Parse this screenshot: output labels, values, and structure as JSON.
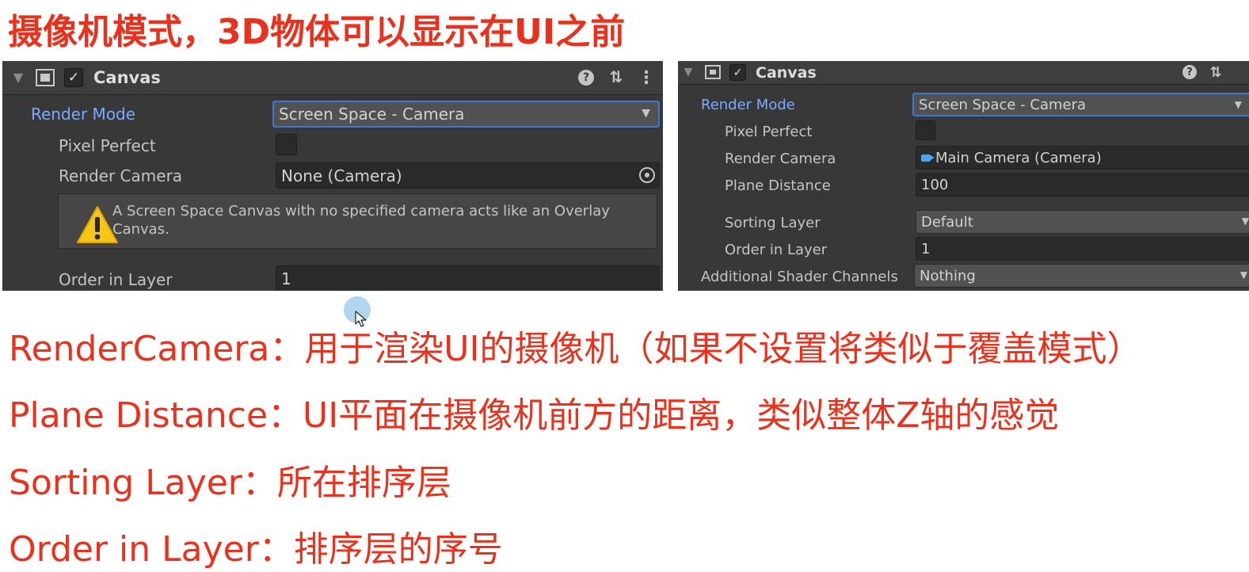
{
  "slide_title": "摄像机模式，3D物体可以显示在UI之前",
  "left_panel": {
    "component_title": "Canvas",
    "render_mode": {
      "label": "Render Mode",
      "value": "Screen Space - Camera"
    },
    "pixel_perfect": {
      "label": "Pixel Perfect",
      "checked": false
    },
    "render_camera": {
      "label": "Render Camera",
      "value": "None (Camera)"
    },
    "warning": "A Screen Space Canvas with no specified camera acts like an Overlay Canvas.",
    "order_in_layer": {
      "label": "Order in Layer",
      "value": "1"
    }
  },
  "right_panel": {
    "component_title": "Canvas",
    "render_mode": {
      "label": "Render Mode",
      "value": "Screen Space - Camera"
    },
    "pixel_perfect": {
      "label": "Pixel Perfect",
      "checked": false
    },
    "render_camera": {
      "label": "Render Camera",
      "value": "Main Camera (Camera)"
    },
    "plane_distance": {
      "label": "Plane Distance",
      "value": "100"
    },
    "sorting_layer": {
      "label": "Sorting Layer",
      "value": "Default"
    },
    "order_in_layer": {
      "label": "Order in Layer",
      "value": "1"
    },
    "additional_shader_channels": {
      "label": "Additional Shader Channels",
      "value": "Nothing"
    }
  },
  "notes": [
    "RenderCamera：用于渲染UI的摄像机（如果不设置将类似于覆盖模式）",
    "Plane Distance：UI平面在摄像机前方的距离，类似整体Z轴的感觉",
    "Sorting Layer：所在排序层",
    "Order in Layer：排序层的序号"
  ],
  "icons": {
    "foldout": "triangle-down-icon",
    "component": "canvas-component-icon",
    "enabled": "checkmark-icon",
    "help": "help-icon",
    "presets": "sliders-icon",
    "menu": "kebab-menu-icon",
    "warning": "warning-icon",
    "picker": "object-picker-icon",
    "camera": "camera-icon"
  },
  "colors": {
    "accent_red": "#e8321e",
    "inspector_bg": "#383838",
    "label_blue": "#7ba9ff",
    "warning_yellow": "#f5c518",
    "focus_blue": "#3a79d9"
  }
}
